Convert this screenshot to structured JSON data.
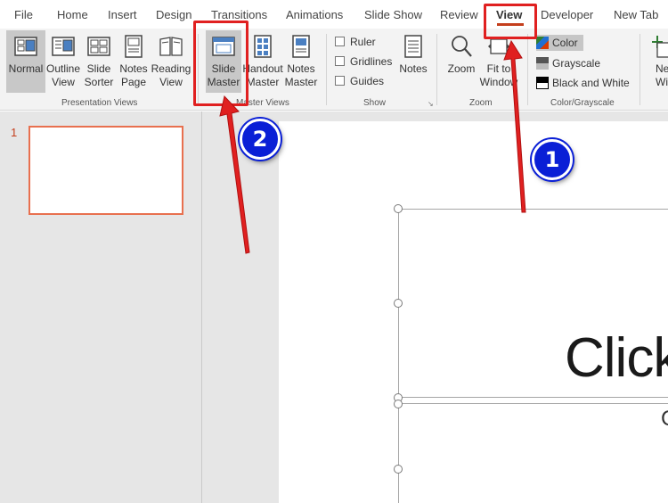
{
  "menu": {
    "tabs": [
      "File",
      "Home",
      "Insert",
      "Design",
      "Transitions",
      "Animations",
      "Slide Show",
      "Review",
      "View",
      "Developer",
      "New Tab"
    ],
    "active_tab": "View"
  },
  "ribbon": {
    "presentation_views": {
      "label": "Presentation Views",
      "buttons": [
        {
          "label": "Normal",
          "icon": "normal-view-icon",
          "selected": true
        },
        {
          "label": "Outline View",
          "icon": "outline-view-icon"
        },
        {
          "label": "Slide Sorter",
          "icon": "slide-sorter-icon"
        },
        {
          "label": "Notes Page",
          "icon": "notes-page-icon"
        },
        {
          "label": "Reading View",
          "icon": "reading-view-icon"
        }
      ]
    },
    "master_views": {
      "label": "Master Views",
      "buttons": [
        {
          "label": "Slide Master",
          "icon": "slide-master-icon",
          "selected": true
        },
        {
          "label": "Handout Master",
          "icon": "handout-master-icon"
        },
        {
          "label": "Notes Master",
          "icon": "notes-master-icon"
        }
      ]
    },
    "show": {
      "label": "Show",
      "checkboxes": [
        "Ruler",
        "Gridlines",
        "Guides"
      ],
      "notes_button": "Notes"
    },
    "zoom": {
      "label": "Zoom",
      "buttons": [
        "Zoom",
        "Fit to Window"
      ]
    },
    "color_grayscale": {
      "label": "Color/Grayscale",
      "options": [
        "Color",
        "Grayscale",
        "Black and White"
      ],
      "selected": "Color"
    },
    "window": {
      "new_window": "New Window"
    }
  },
  "slides_pane": {
    "slide_number": "1"
  },
  "slide": {
    "title_text": "Click",
    "subtitle_text": "C"
  },
  "annotations": {
    "step1": "1",
    "step2": "2"
  },
  "colors": {
    "accent": "#c43e1c",
    "highlight": "#e02020",
    "badge": "#0a1fd6"
  }
}
